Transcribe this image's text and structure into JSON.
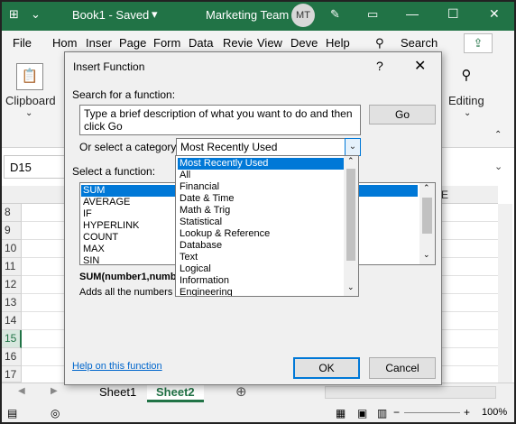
{
  "titlebar": {
    "autosave_icon": "grid-icon",
    "doc_title": "Book1 - Saved",
    "team": "Marketing Team",
    "avatar_initials": "MT",
    "accent": "#217346"
  },
  "ribbon_tabs": [
    "File",
    "Hom",
    "Inser",
    "Page",
    "Form",
    "Data",
    "Revie",
    "View",
    "Deve",
    "Help"
  ],
  "search_label": "Search",
  "ribbon": {
    "clipboard": "Clipboard",
    "editing": "Editing"
  },
  "formula_bar": {
    "namebox": "D15"
  },
  "grid": {
    "col_header_visible": "E",
    "rows": [
      "8",
      "9",
      "10",
      "11",
      "12",
      "13",
      "14",
      "15",
      "16",
      "17"
    ],
    "selected_row": "15"
  },
  "sheets": [
    "Sheet1",
    "Sheet2"
  ],
  "active_sheet": "Sheet2",
  "status": {
    "zoom": "100%"
  },
  "dialog": {
    "title": "Insert Function",
    "help_glyph": "?",
    "close_glyph": "✕",
    "search_label": "Search for a function:",
    "search_value": "Type a brief description of what you want to do and then click Go",
    "go_label": "Go",
    "category_label": "Or select a category:",
    "category_value": "Most Recently Used",
    "function_label": "Select a function:",
    "functions": [
      "SUM",
      "AVERAGE",
      "IF",
      "HYPERLINK",
      "COUNT",
      "MAX",
      "SIN"
    ],
    "selected_function": "SUM",
    "syntax": "SUM(number1,numb",
    "description": "Adds all the numbers",
    "help_link": "Help on this function",
    "ok_label": "OK",
    "cancel_label": "Cancel"
  },
  "category_dropdown": {
    "options": [
      "Most Recently Used",
      "All",
      "Financial",
      "Date & Time",
      "Math & Trig",
      "Statistical",
      "Lookup & Reference",
      "Database",
      "Text",
      "Logical",
      "Information",
      "Engineering"
    ],
    "selected": "Most Recently Used"
  }
}
